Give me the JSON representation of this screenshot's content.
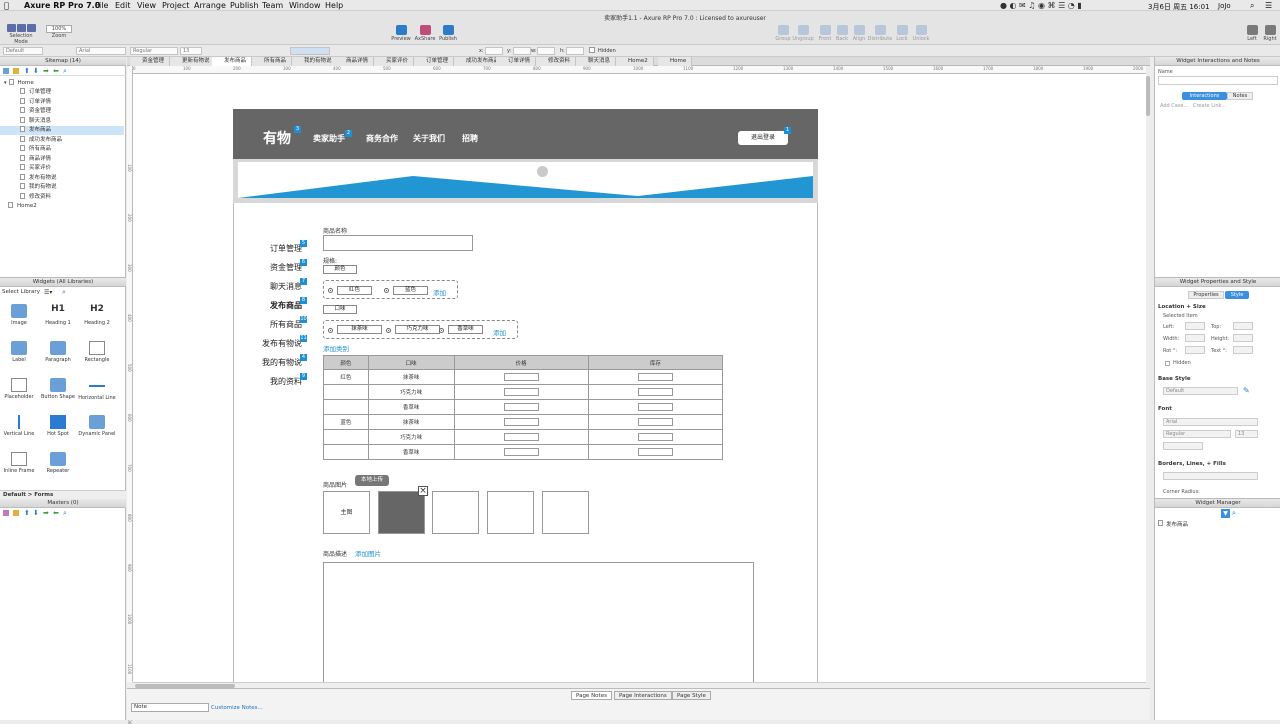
{
  "menubar": {
    "app_name": "Axure RP Pro 7.0",
    "menus": [
      "File",
      "Edit",
      "View",
      "Project",
      "Arrange",
      "Publish",
      "Team",
      "Window",
      "Help"
    ],
    "clock": "3月6日 周五 16:01",
    "user": "JoJo"
  },
  "window_title": "卖家助手1.1 - Axure RP Pro 7.0 : Licensed to axureuser",
  "toolbar": {
    "selection_mode": "Selection Mode",
    "zoom_label": "Zoom",
    "zoom_value": "100%",
    "preview": "Preview",
    "axshare": "AxShare",
    "publish": "Publish",
    "arrange": [
      "Group",
      "Ungroup",
      "Front",
      "Back",
      "Align",
      "Distribute",
      "Lock",
      "Unlock"
    ],
    "left": "Left",
    "right": "Right"
  },
  "formatbar": {
    "style": "Default",
    "font": "Arial",
    "weight": "Regular",
    "size": "13",
    "x": "x:",
    "y": "y:",
    "w": "w:",
    "h": "h:",
    "hidden": "Hidden"
  },
  "sitemap": {
    "title": "Sitemap (14)",
    "home": "Home",
    "children": [
      "订单管理",
      "订单详情",
      "资金管理",
      "聊天消息",
      "发布商品",
      "成功发布商品",
      "所有商品",
      "商品详情",
      "买家评价",
      "发布有物说",
      "我的有物说",
      "修改资料"
    ],
    "selected_index": 4,
    "home2": "Home2"
  },
  "widgets": {
    "title": "Widgets (All Libraries)",
    "select_library": "Select Library",
    "items": [
      "Image",
      "Heading 1",
      "Heading 2",
      "Label",
      "Paragraph",
      "Rectangle",
      "Placeholder",
      "Button Shape",
      "Horizontal Line",
      "Vertical Line",
      "Hot Spot",
      "Dynamic Panel",
      "Inline Frame",
      "Repeater"
    ],
    "h1_glyph": "H1",
    "h2_glyph": "H2",
    "footer": "Default > Forms"
  },
  "masters": {
    "title": "Masters (0)"
  },
  "page_tabs": [
    "资金管理",
    "更新有物说",
    "发布商品",
    "所有商品",
    "我的有物说",
    "商品详情",
    "买家评价",
    "订单管理",
    "成功发布商品",
    "订单详情",
    "修改资料",
    "聊天消息",
    "Home2",
    "Home"
  ],
  "active_tab": "发布商品",
  "ruler_h": [
    "0",
    "100",
    "200",
    "300",
    "400",
    "500",
    "600",
    "700",
    "800",
    "900",
    "1000",
    "1100",
    "1200",
    "1300",
    "1400",
    "1500",
    "1600",
    "1700",
    "1800",
    "1900",
    "2000"
  ],
  "ruler_v": [
    "100",
    "200",
    "300",
    "400",
    "500",
    "600",
    "700",
    "800",
    "900",
    "1000",
    "1100",
    "1200"
  ],
  "mock": {
    "brand": "有物",
    "nav": [
      "卖家助手",
      "商务合作",
      "关于我们",
      "招聘"
    ],
    "logout": "退出登录",
    "badges": {
      "brand": "3",
      "nav": "2",
      "logout": "1"
    },
    "sidebar": [
      {
        "label": "订单管理",
        "badge": "5"
      },
      {
        "label": "资金管理",
        "badge": "6"
      },
      {
        "label": "聊天消息",
        "badge": "7"
      },
      {
        "label": "发布商品",
        "badge": "8"
      },
      {
        "label": "所有商品",
        "badge": "10"
      },
      {
        "label": "发布有物说",
        "badge": "11"
      },
      {
        "label": "我的有物说",
        "badge": "4"
      },
      {
        "label": "我的资料",
        "badge": "9"
      }
    ],
    "product_name_label": "商品名称",
    "spec_label": "规格:",
    "color_tag": "颜色",
    "colors": [
      "红色",
      "蓝色"
    ],
    "flavor_tag": "口味",
    "flavors": [
      "抹茶味",
      "巧克力味",
      "香草味"
    ],
    "add": "添加",
    "add_category": "添加类别",
    "table": {
      "headers": [
        "颜色",
        "口味",
        "价格",
        "库存"
      ],
      "rows": [
        {
          "color": "红色",
          "flavor": "抹茶味"
        },
        {
          "color": "",
          "flavor": "巧克力味"
        },
        {
          "color": "",
          "flavor": "香草味"
        },
        {
          "color": "蓝色",
          "flavor": "抹茶味"
        },
        {
          "color": "",
          "flavor": "巧克力味"
        },
        {
          "color": "",
          "flavor": "香草味"
        }
      ]
    },
    "image_label": "商品图片",
    "upload_btn": "本地上传",
    "main_image": "主图",
    "desc_label": "商品描述",
    "add_image": "添加图片"
  },
  "right": {
    "interactions_title": "Widget Interactions and Notes",
    "name_label": "Name",
    "tab_interactions": "Interactions",
    "tab_notes": "Notes",
    "add_case": "Add Case...",
    "create_link": "Create Link...",
    "props_title": "Widget Properties and Style",
    "tab_properties": "Properties",
    "tab_style": "Style",
    "loc_size": "Location + Size",
    "selected_item": "Selected Item",
    "left": "Left:",
    "top": "Top:",
    "width": "Width:",
    "height": "Height:",
    "rot": "Rot °:",
    "text": "Text °:",
    "hidden": "Hidden",
    "base_style": "Base Style",
    "base_default": "Default",
    "font": "Font",
    "font_name": "Arial",
    "font_weight": "Regular",
    "font_size": "13",
    "borders": "Borders, Lines, + Fills",
    "corner": "Corner Radius:",
    "manager_title": "Widget Manager",
    "manager_item": "发布商品"
  },
  "bottom": {
    "tabs": [
      "Page Notes",
      "Page Interactions",
      "Page Style"
    ],
    "active": "Page Notes",
    "note_select": "Note",
    "customize": "Customize Notes..."
  },
  "colors": {
    "accent": "#1e8fd5",
    "nav_bg": "#666666",
    "banner": "#2196d3"
  }
}
